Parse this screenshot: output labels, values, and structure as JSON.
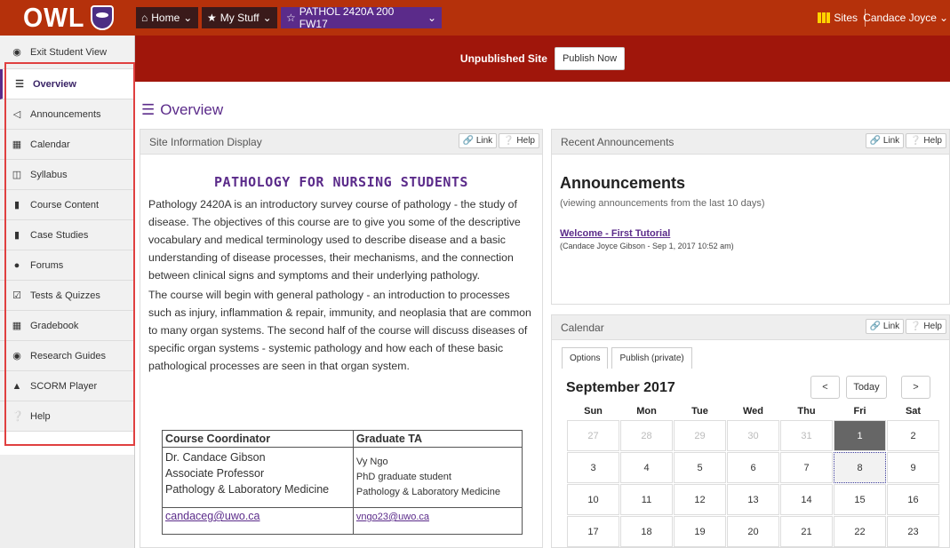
{
  "logo": {
    "text": "OWL"
  },
  "topnav": {
    "home": "Home",
    "mystuff": "My Stuff",
    "site": "PATHOL 2420A 200 FW17",
    "sites": "Sites",
    "user": "Candace Joyce"
  },
  "sidebar": {
    "items": [
      {
        "label": "Exit Student View",
        "icon": "eye-icon"
      },
      {
        "label": "Overview",
        "icon": "list-icon"
      },
      {
        "label": "Announcements",
        "icon": "megaphone-icon"
      },
      {
        "label": "Calendar",
        "icon": "calendar-icon"
      },
      {
        "label": "Syllabus",
        "icon": "map-icon"
      },
      {
        "label": "Course Content",
        "icon": "book-icon"
      },
      {
        "label": "Case Studies",
        "icon": "book-icon"
      },
      {
        "label": "Forums",
        "icon": "comments-icon"
      },
      {
        "label": "Tests & Quizzes",
        "icon": "checkbox-icon"
      },
      {
        "label": "Gradebook",
        "icon": "table-icon"
      },
      {
        "label": "Research Guides",
        "icon": "globe-icon"
      },
      {
        "label": "SCORM Player",
        "icon": "sitemap-icon"
      },
      {
        "label": "Help",
        "icon": "question-icon"
      }
    ]
  },
  "publish": {
    "label": "Unpublished Site",
    "button": "Publish Now"
  },
  "page": {
    "title": "Overview"
  },
  "site_info": {
    "header": "Site Information Display",
    "link_btn": "Link",
    "help_btn": "Help",
    "course_title": "PATHOLOGY FOR NURSING STUDENTS",
    "para1": "Pathology 2420A is an introductory survey course of pathology - the study of disease. The objectives of this course are to give you some of the descriptive vocabulary and medical terminology used to describe disease and a basic understanding of disease processes, their mechanisms, and the connection between clinical signs and symptoms and their underlying pathology.",
    "para2": "The course will begin with general pathology - an introduction to processes such as injury, inflammation & repair, immunity, and neoplasia that are common to many organ systems. The second half of the course will discuss diseases of specific organ systems - systemic pathology and how each of these basic pathological processes are seen in that organ system.",
    "table": {
      "col1_head": "Course Coordinator",
      "col2_head": "Graduate TA",
      "coord_name": "Dr. Candace Gibson",
      "coord_title": "Associate Professor",
      "coord_dept": "Pathology & Laboratory Medicine",
      "ta_name": "Vy Ngo",
      "ta_title": "PhD graduate student",
      "ta_dept": "Pathology & Laboratory Medicine",
      "coord_email": "candaceg@uwo.ca",
      "ta_email": "vngo23@uwo.ca"
    }
  },
  "announcements": {
    "header": "Recent Announcements",
    "link_btn": "Link",
    "help_btn": "Help",
    "title": "Announcements",
    "subtitle": "(viewing announcements from the last 10 days)",
    "item_title": "Welcome - First Tutorial",
    "item_meta": "(Candace Joyce Gibson - Sep 1, 2017 10:52 am)"
  },
  "calendar": {
    "header": "Calendar",
    "link_btn": "Link",
    "help_btn": "Help",
    "tab_options": "Options",
    "tab_publish": "Publish (private)",
    "month_title": "September 2017",
    "prev": "<",
    "today": "Today",
    "next": ">",
    "dows": [
      "Sun",
      "Mon",
      "Tue",
      "Wed",
      "Thu",
      "Fri",
      "Sat"
    ],
    "weeks": [
      [
        "27",
        "28",
        "29",
        "30",
        "31",
        "1",
        "2"
      ],
      [
        "3",
        "4",
        "5",
        "6",
        "7",
        "8",
        "9"
      ],
      [
        "10",
        "11",
        "12",
        "13",
        "14",
        "15",
        "16"
      ],
      [
        "17",
        "18",
        "19",
        "20",
        "21",
        "22",
        "23"
      ]
    ]
  }
}
